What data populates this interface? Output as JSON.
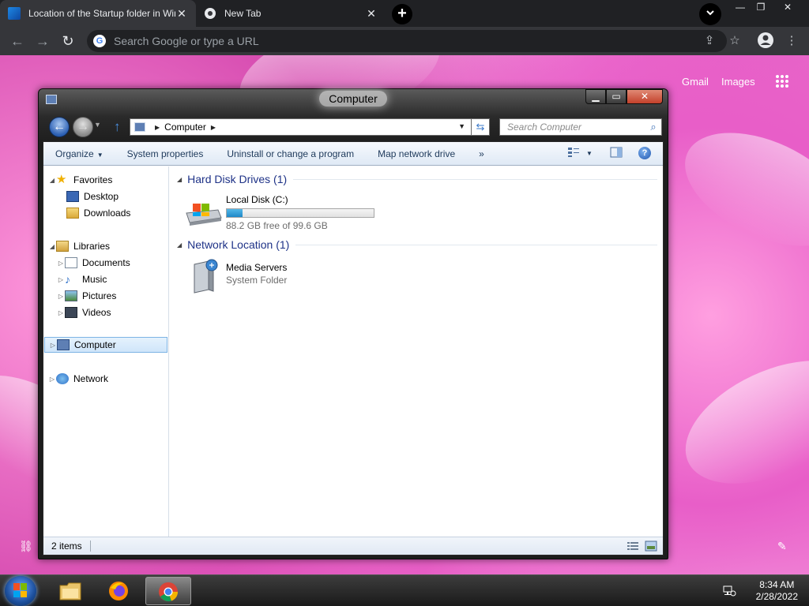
{
  "browser": {
    "tabs": [
      {
        "title": "Location of the Startup folder in Windows"
      },
      {
        "title": "New Tab"
      }
    ],
    "tab_close": "✕",
    "new_tab": "+",
    "omnibox_placeholder": "Search Google or type a URL",
    "window_buttons": {
      "minimize": "—",
      "maximize": "❐",
      "close": "✕"
    }
  },
  "ntp": {
    "links": [
      "Gmail",
      "Images"
    ]
  },
  "explorer": {
    "title": "Computer",
    "address": [
      "Computer"
    ],
    "search_placeholder": "Search Computer",
    "commands": [
      {
        "label": "Organize"
      },
      {
        "label": "System properties"
      },
      {
        "label": "Uninstall or change a program"
      },
      {
        "label": "Map network drive"
      },
      {
        "label": "»"
      }
    ],
    "nav": {
      "favorites": "Favorites",
      "desktop": "Desktop",
      "downloads": "Downloads",
      "libraries": "Libraries",
      "documents": "Documents",
      "music": "Music",
      "pictures": "Pictures",
      "videos": "Videos",
      "computer": "Computer",
      "network": "Network"
    },
    "groups": {
      "hdd": "Hard Disk Drives (1)",
      "network": "Network Location (1)"
    },
    "drive": {
      "name": "Local Disk (C:)",
      "free": "88.2 GB free of 99.6 GB",
      "used_fraction": 0.11
    },
    "media": {
      "name": "Media Servers",
      "type": "System Folder"
    },
    "status": "2 items"
  },
  "taskbar": {
    "time": "8:34 AM",
    "date": "2/28/2022"
  }
}
